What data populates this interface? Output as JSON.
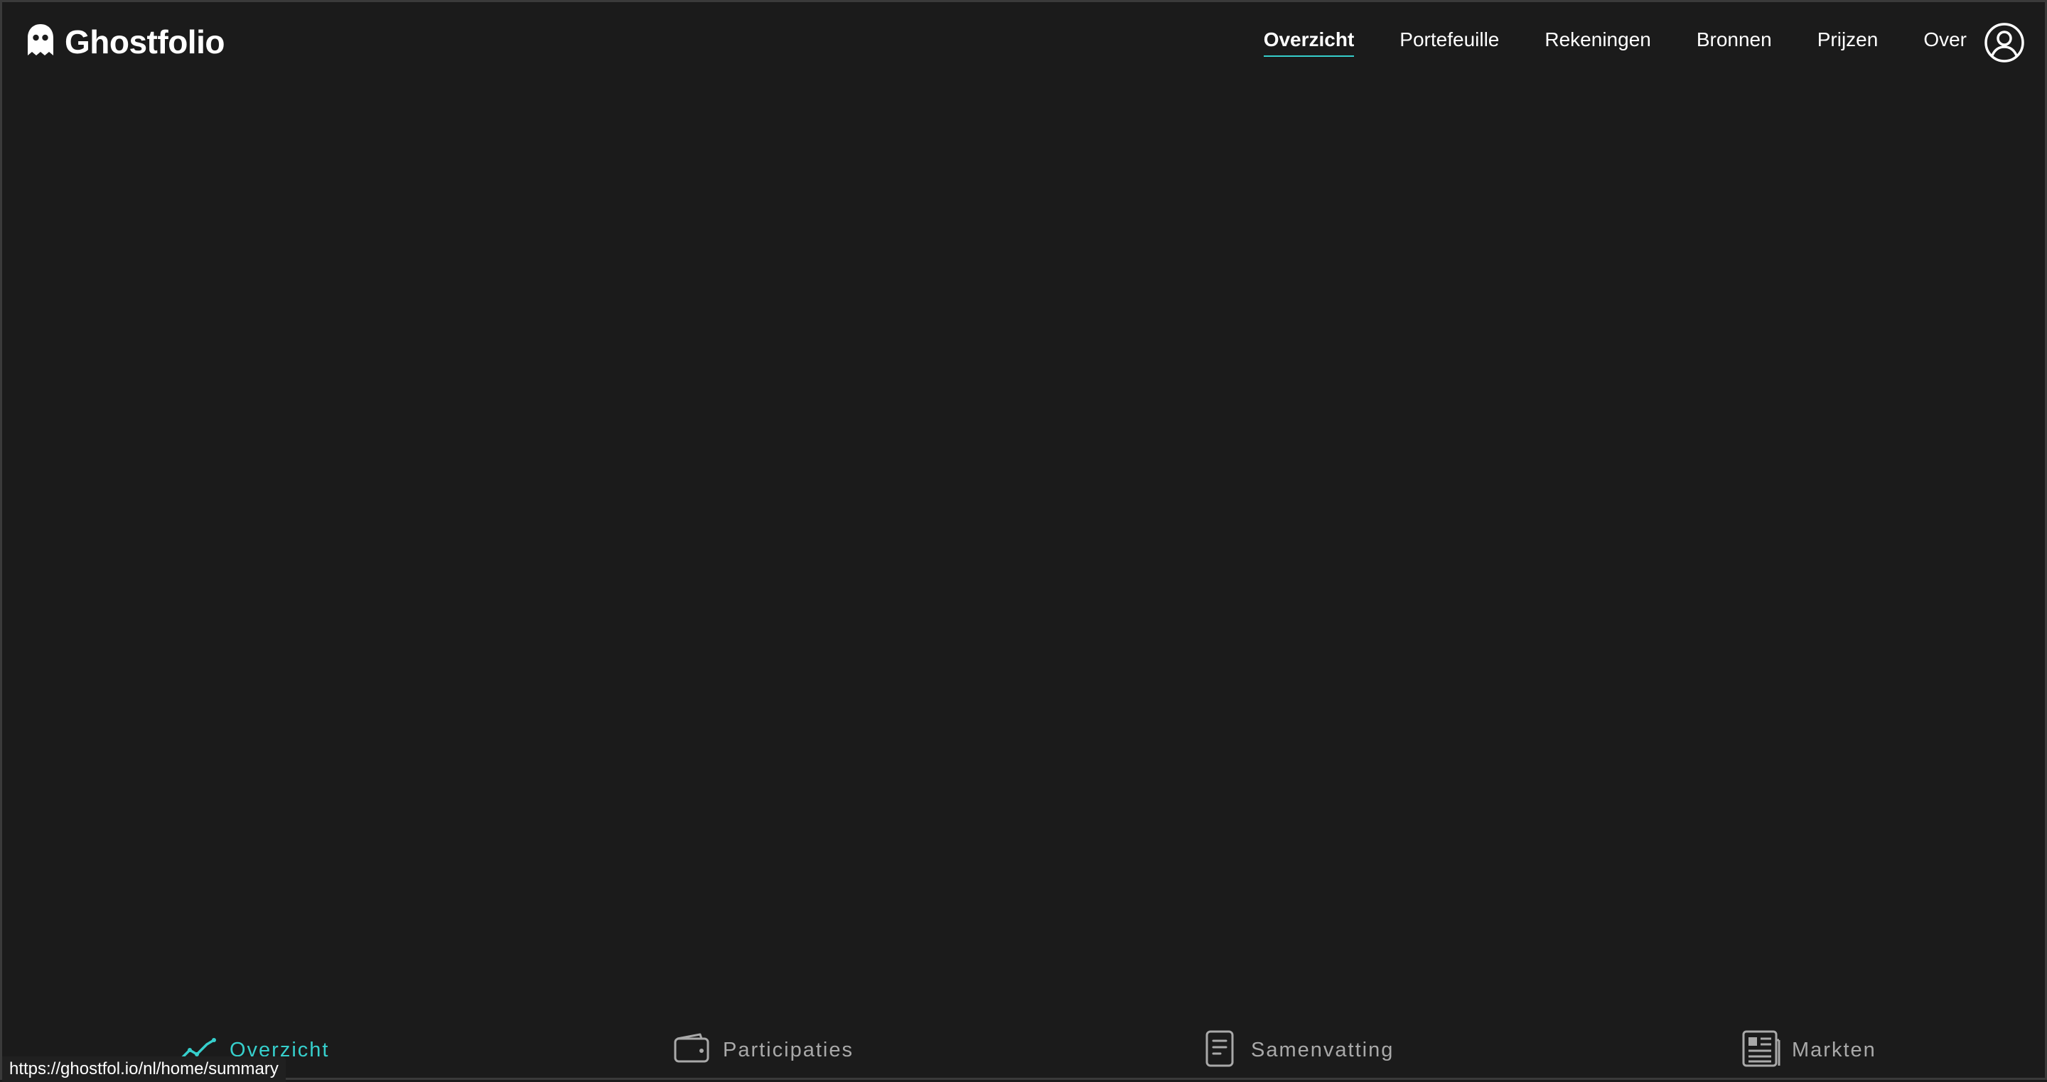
{
  "brand": {
    "name": "Ghostfolio",
    "logo_icon": "ghost-icon"
  },
  "nav": {
    "items": [
      {
        "label": "Overzicht",
        "active": true
      },
      {
        "label": "Portefeuille",
        "active": false
      },
      {
        "label": "Rekeningen",
        "active": false
      },
      {
        "label": "Bronnen",
        "active": false
      },
      {
        "label": "Prijzen",
        "active": false
      },
      {
        "label": "Over",
        "active": false
      }
    ],
    "user_icon": "user-circle-icon"
  },
  "tabs": [
    {
      "label": "Overzicht",
      "icon": "trend-line-icon",
      "active": true
    },
    {
      "label": "Participaties",
      "icon": "wallet-icon",
      "active": false
    },
    {
      "label": "Samenvatting",
      "icon": "document-icon",
      "active": false
    },
    {
      "label": "Markten",
      "icon": "newspaper-icon",
      "active": false
    }
  ],
  "status_bar": {
    "url": "https://ghostfol.io/nl/home/summary"
  },
  "colors": {
    "background": "#1b1b1b",
    "accent": "#36cfcc",
    "muted_text": "#a9a9a9",
    "text": "#ffffff"
  }
}
